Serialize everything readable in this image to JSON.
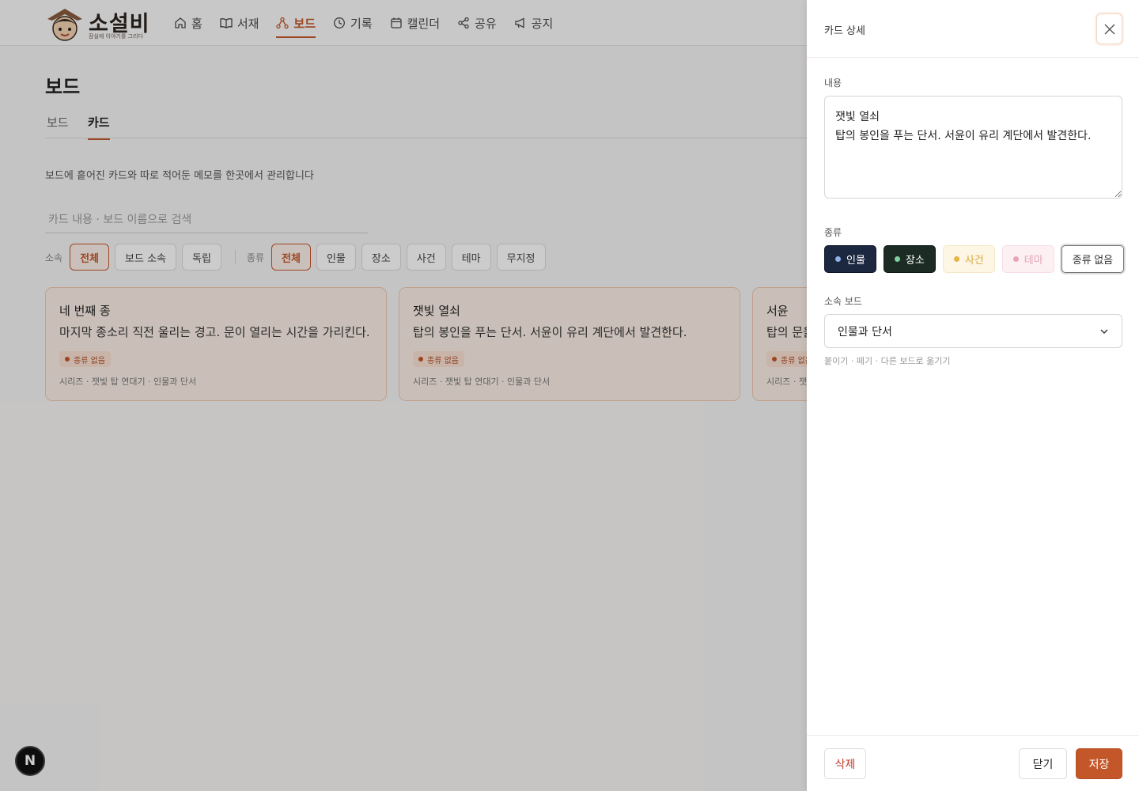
{
  "app": {
    "logo_text": "소설비",
    "logo_sub": "잠실에 이야기를 그리다",
    "nav": [
      {
        "label": "홈",
        "icon": "home-icon"
      },
      {
        "label": "서재",
        "icon": "book-icon"
      },
      {
        "label": "보드",
        "icon": "board-icon",
        "active": true
      },
      {
        "label": "기록",
        "icon": "clock-icon"
      },
      {
        "label": "캘린더",
        "icon": "calendar-icon"
      },
      {
        "label": "공유",
        "icon": "share-icon"
      },
      {
        "label": "공지",
        "icon": "megaphone-icon"
      }
    ]
  },
  "page": {
    "title": "보드",
    "tabs": [
      "보드",
      "카드"
    ],
    "description": "보드에 흩어진 카드와 따로 적어둔 메모를 한곳에서 관리합니다",
    "search_placeholder": "카드 내용 · 보드 이름으로 검색",
    "filters": {
      "group_label": "소속",
      "group_options": [
        "전체",
        "보드 소속",
        "독립"
      ],
      "type_label": "종류",
      "type_options": [
        "전체",
        "인물",
        "장소",
        "사건",
        "테마",
        "무지정"
      ]
    },
    "cards": [
      {
        "title": "네 번째 종",
        "body": "마지막 종소리 직전 울리는 경고. 문이 열리는 시간을 가리킨다.",
        "badge": "종류 없음",
        "meta": "시리즈 · 잿빛 탑 연대기 · 인물과 단서"
      },
      {
        "title": "잿빛 열쇠",
        "body": "탑의 봉인을 푸는 단서. 서윤이 유리 계단에서 발견한다.",
        "badge": "종류 없음",
        "meta": "시리즈 · 잿빛 탑 연대기 · 인물과 단서"
      },
      {
        "title": "서윤",
        "body": "탑의 문을",
        "badge": "종류 없음",
        "meta": "시리즈 · 잿빛"
      }
    ]
  },
  "panel": {
    "title": "카드 상세",
    "content_label": "내용",
    "content_value": "잿빛 열쇠\n탑의 봉인을 푸는 단서. 서윤이 유리 계단에서 발견한다.",
    "type_label": "종류",
    "types": [
      "인물",
      "장소",
      "사건",
      "테마",
      "종류 없음"
    ],
    "selected_type": "종류 없음",
    "board_label": "소속 보드",
    "board_value": "인물과 단서",
    "hint": "붙이기 · 떼기 · 다른 보드로 옮기기",
    "delete_label": "삭제",
    "close_label": "닫기",
    "save_label": "저장"
  },
  "floating": {
    "n_label": "N"
  },
  "colors": {
    "accent": "#c4572a",
    "person": "#1c2740",
    "place": "#1c2c24",
    "event": "#fdf6e4",
    "theme": "#fdf0f3"
  }
}
